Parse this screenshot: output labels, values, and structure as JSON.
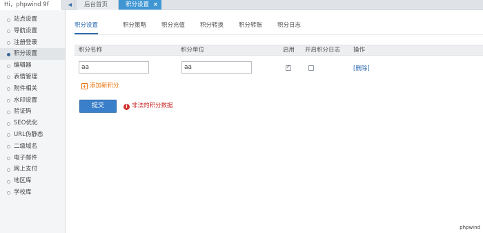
{
  "topbar": {
    "user_text": "Hi，phpwind 9f",
    "tabs": [
      {
        "label": "后台首页"
      },
      {
        "label": "积分设置",
        "close": "×"
      }
    ]
  },
  "sidebar": {
    "items": [
      {
        "label": "站点设置"
      },
      {
        "label": "导航设置"
      },
      {
        "label": "注册登录"
      },
      {
        "label": "积分设置",
        "active": true
      },
      {
        "label": "编辑器"
      },
      {
        "label": "表情管理"
      },
      {
        "label": "附件相关"
      },
      {
        "label": "水印设置"
      },
      {
        "label": "验证码"
      },
      {
        "label": "SEO优化"
      },
      {
        "label": "URL伪静态"
      },
      {
        "label": "二级域名"
      },
      {
        "label": "电子邮件"
      },
      {
        "label": "网上支付"
      },
      {
        "label": "地区库"
      },
      {
        "label": "学校库"
      }
    ]
  },
  "subnav": {
    "tabs": [
      {
        "label": "积分设置",
        "active": true
      },
      {
        "label": "积分策略"
      },
      {
        "label": "积分充值"
      },
      {
        "label": "积分转换"
      },
      {
        "label": "积分转账"
      },
      {
        "label": "积分日志"
      }
    ]
  },
  "table": {
    "headers": {
      "name": "积分名称",
      "unit": "积分单位",
      "enabled": "启用",
      "log": "开启积分日志",
      "action": "操作"
    },
    "rows": [
      {
        "name": "aa",
        "unit": "aa",
        "enabled": true,
        "log": false,
        "action": "[删除]"
      }
    ]
  },
  "add_label": "添加新积分",
  "submit_label": "提交",
  "error_text": "非法的积分数据",
  "brand": "phpwind",
  "colors": {
    "accent": "#3f96d3",
    "link": "#2d6db2",
    "error": "#c62828",
    "add": "#e8730c"
  }
}
